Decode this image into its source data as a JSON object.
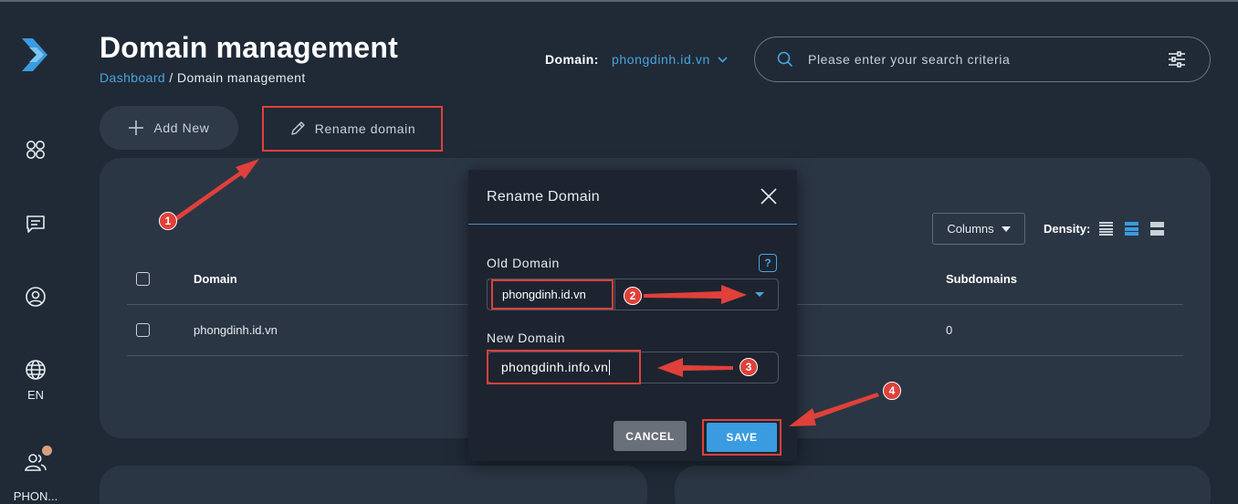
{
  "sidebar": {
    "items": [
      {
        "name": "apps",
        "icon": "apps-icon"
      },
      {
        "name": "messages",
        "icon": "message-icon"
      },
      {
        "name": "profile",
        "icon": "user-circle-icon"
      },
      {
        "name": "language",
        "icon": "globe-icon",
        "label": "EN"
      },
      {
        "name": "account",
        "icon": "users-icon",
        "label": "PHON..."
      }
    ]
  },
  "header": {
    "title": "Domain management",
    "breadcrumb": {
      "link": "Dashboard",
      "separator": " / ",
      "current": "Domain management"
    },
    "domain_label": "Domain:",
    "domain_value": "phongdinh.id.vn",
    "search": {
      "placeholder": "Please enter your search criteria",
      "value": ""
    }
  },
  "actions": {
    "add_label": "Add New",
    "rename_label": "Rename domain"
  },
  "table": {
    "columns_label": "Columns",
    "density_label": "Density:",
    "headers": [
      "Domain",
      "Subdomains"
    ],
    "rows": [
      {
        "domain": "phongdinh.id.vn",
        "subdomains": "0"
      }
    ]
  },
  "modal": {
    "title": "Rename Domain",
    "old_domain_label": "Old Domain",
    "help_label": "?",
    "old_domain_value": "phongdinh.id.vn",
    "new_domain_label": "New Domain",
    "new_domain_value": "phongdinh.info.vn",
    "cancel_label": "CANCEL",
    "save_label": "SAVE"
  },
  "annotations": {
    "steps": [
      "1",
      "2",
      "3",
      "4"
    ]
  },
  "colors": {
    "background": "#1f2a36",
    "card": "#2b3644",
    "accent": "#4aa3df",
    "highlight": "#e0403a",
    "save": "#3a9be0"
  }
}
